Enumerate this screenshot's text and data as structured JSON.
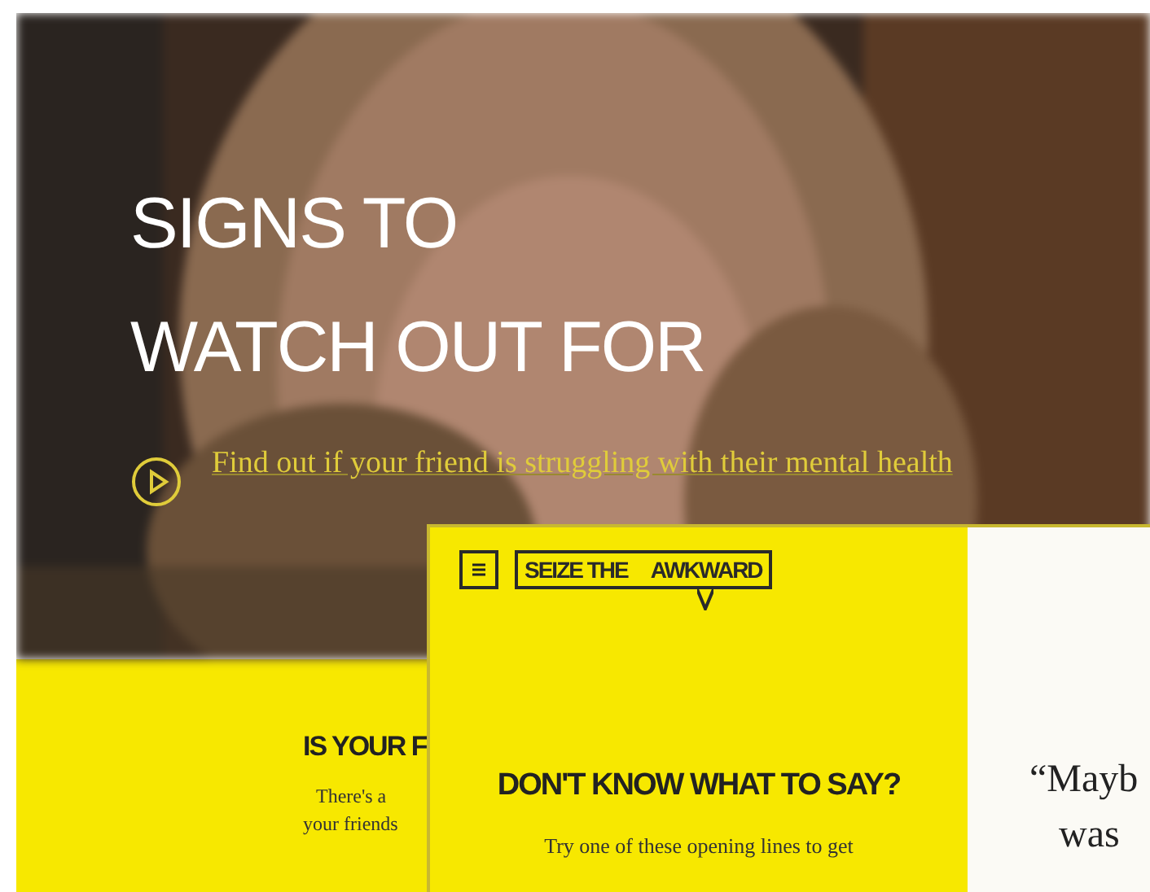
{
  "back_page": {
    "hero": {
      "kind": "picture",
      "heading": "SIGNS TO WATCH OUT FOR",
      "link": "Find out if your friend is struggling with their mental health"
    },
    "section": {
      "heading": "IS YOUR F",
      "lines": [
        "There's a",
        "your friends"
      ]
    }
  },
  "front_page": {
    "logo": [
      "SEIZE THE",
      "AWKWARD"
    ],
    "panel": {
      "heading": "DON'T KNOW WHAT TO SAY?",
      "text": "Try one of these opening lines to get"
    },
    "quote_lines": [
      "“Mayb",
      "was"
    ]
  }
}
